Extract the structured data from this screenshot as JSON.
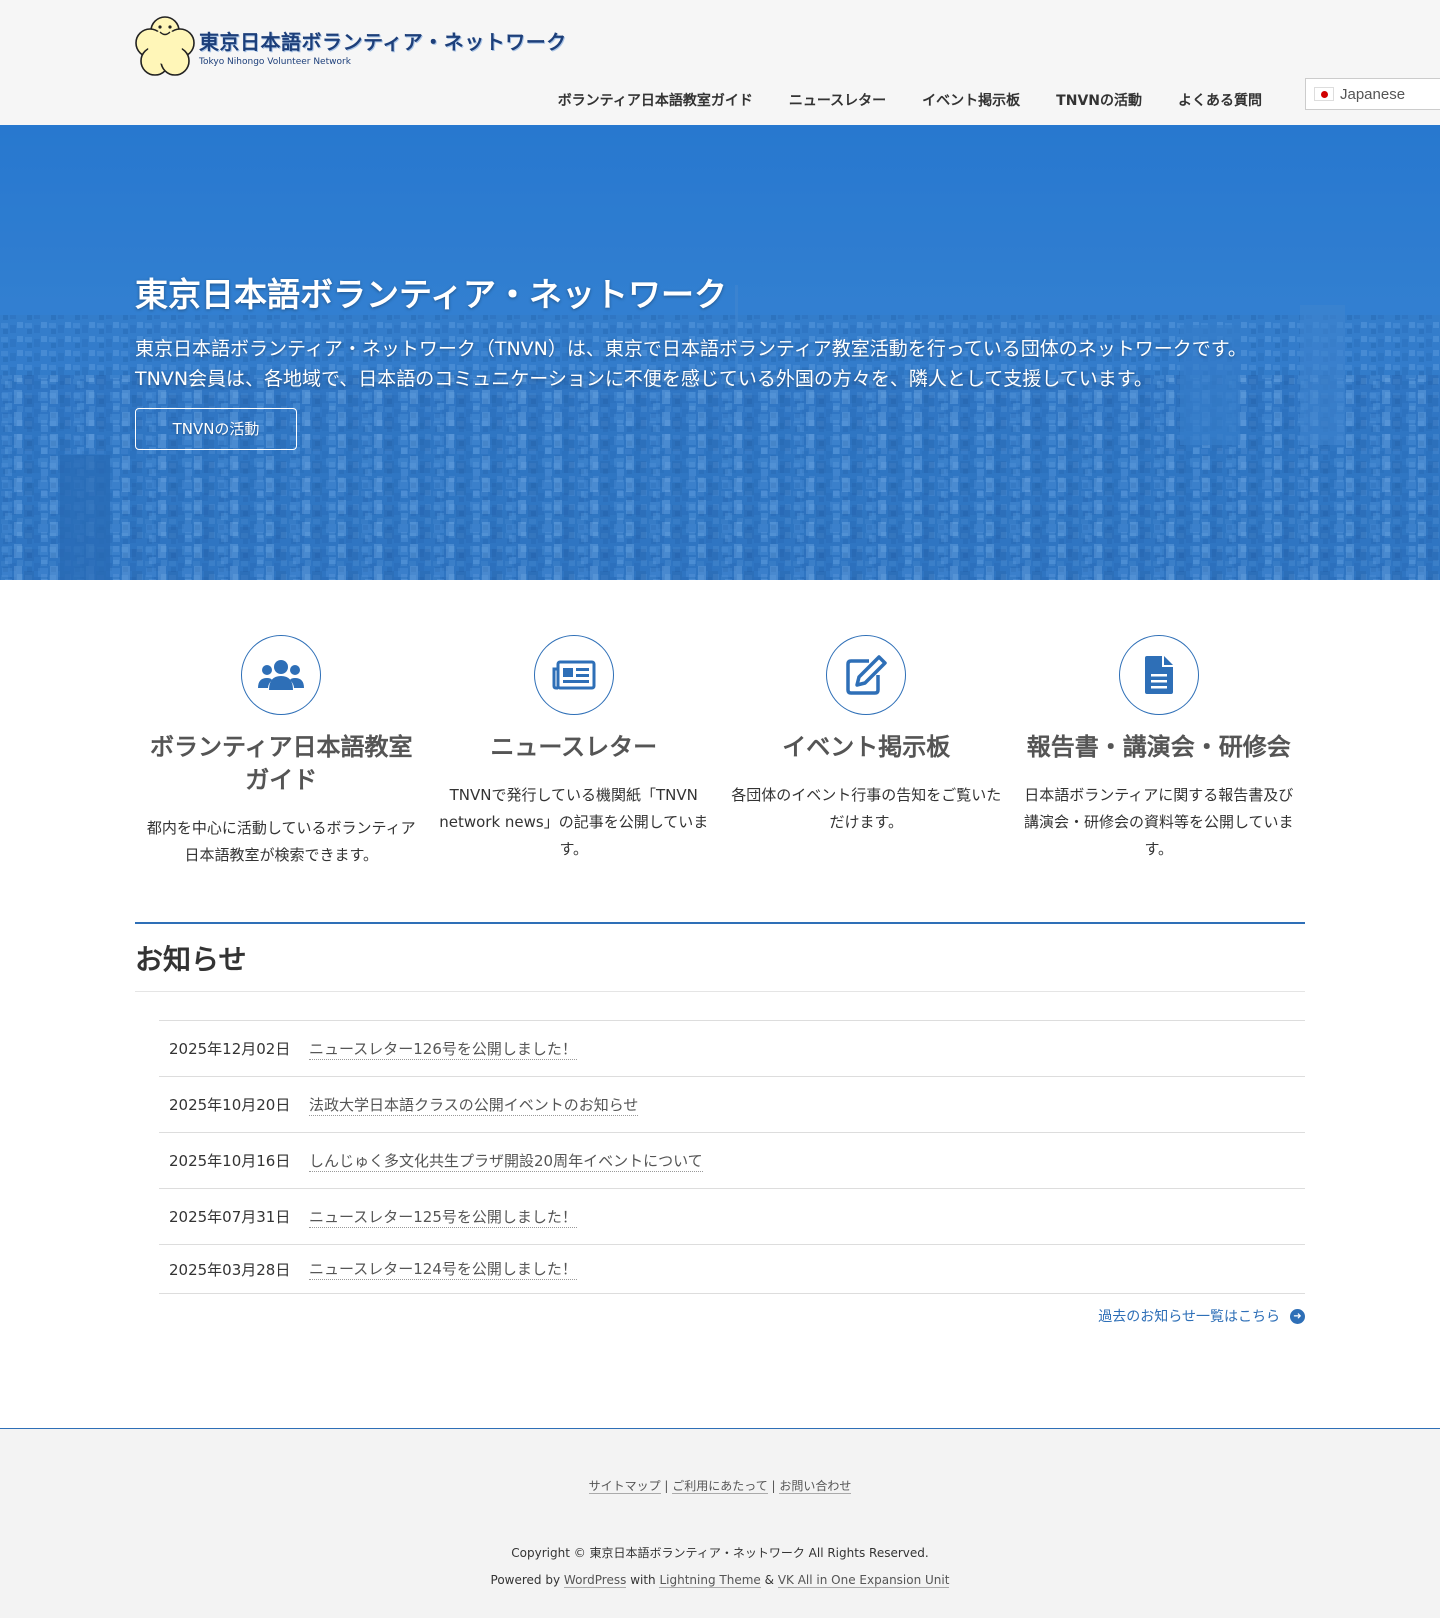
{
  "header": {
    "logo_title": "東京日本語ボランティア・ネットワーク",
    "logo_subtitle": "Tokyo Nihongo Volunteer Network",
    "nav": [
      "ボランティア日本語教室ガイド",
      "ニュースレター",
      "イベント掲示板",
      "TNVNの活動",
      "よくある質問"
    ],
    "language": "Japanese"
  },
  "hero": {
    "title": "東京日本語ボランティア・ネットワーク",
    "text_line1": "東京日本語ボランティア・ネットワーク（TNVN）は、東京で日本語ボランティア教室活動を行っている団体のネットワークです。",
    "text_line2": "TNVN会員は、各地域で、日本語のコミュニケーションに不便を感じている外国の方々を、隣人として支援しています。",
    "button": "TNVNの活動"
  },
  "features": [
    {
      "icon": "users-icon",
      "title": "ボランティア日本語教室ガイド",
      "text": "都内を中心に活動しているボランティア日本語教室が検索できます。"
    },
    {
      "icon": "newspaper-icon",
      "title": "ニュースレター",
      "text": "TNVNで発行している機関紙「TNVN network news」の記事を公開しています。"
    },
    {
      "icon": "edit-icon",
      "title": "イベント掲示板",
      "text": "各団体のイベント行事の告知をご覧いただけます。"
    },
    {
      "icon": "document-icon",
      "title": "報告書・講演会・研修会",
      "text": "日本語ボランティアに関する報告書及び講演会・研修会の資料等を公開しています。"
    }
  ],
  "news": {
    "title": "お知らせ",
    "items": [
      {
        "date": "2025年12月02日",
        "title": "ニュースレター126号を公開しました！"
      },
      {
        "date": "2025年10月20日",
        "title": "法政大学日本語クラスの公開イベントのお知らせ"
      },
      {
        "date": "2025年10月16日",
        "title": "しんじゅく多文化共生プラザ開設20周年イベントについて"
      },
      {
        "date": "2025年07月31日",
        "title": "ニュースレター125号を公開しました！"
      },
      {
        "date": "2025年03月28日",
        "title": "ニュースレター124号を公開しました！"
      }
    ],
    "more": "過去のお知らせ一覧はこちら"
  },
  "footer": {
    "links": [
      "サイトマップ",
      "ご利用にあたって",
      "お問い合わせ"
    ],
    "separator": "|",
    "copyright": "Copyright © 東京日本語ボランティア・ネットワーク All Rights Reserved.",
    "powered_by": "Powered by",
    "wordpress": "WordPress",
    "with": "with",
    "theme": "Lightning Theme",
    "and": "&",
    "unit": "VK All in One Expansion Unit"
  },
  "colors": {
    "accent": "#2e6fb7",
    "hero_blue": "#2d7ad0",
    "logo_blue": "#1d3f7a",
    "logo_yellow": "#fff6b8"
  }
}
